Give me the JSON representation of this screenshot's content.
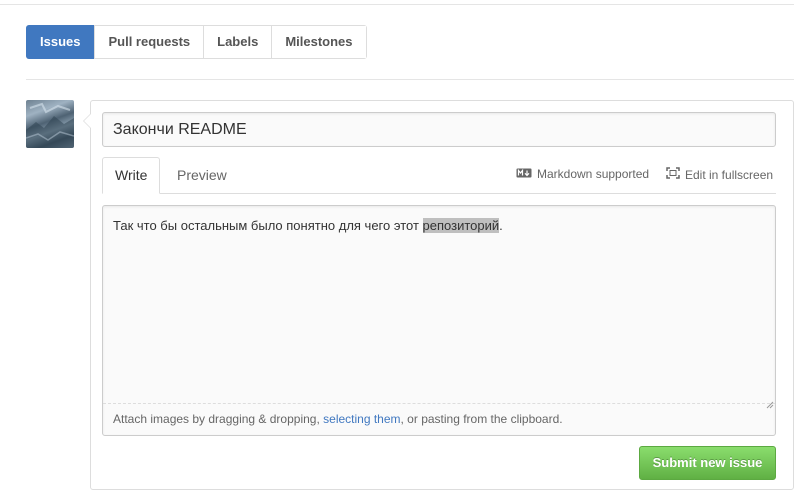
{
  "nav": {
    "tabs": [
      {
        "label": "Issues",
        "active": true
      },
      {
        "label": "Pull requests",
        "active": false
      },
      {
        "label": "Labels",
        "active": false
      },
      {
        "label": "Milestones",
        "active": false
      }
    ]
  },
  "form": {
    "title_value": "Закончи README",
    "tabs": {
      "write": "Write",
      "preview": "Preview"
    },
    "markdown_label": "Markdown supported",
    "fullscreen_label": "Edit in fullscreen",
    "body_text_before": "Так что бы остальным было понятно для чего этот ",
    "body_text_selected": "репозиторий",
    "body_text_after": ".",
    "attach_prefix": "Attach images by dragging & dropping, ",
    "attach_link": "selecting them",
    "attach_suffix": ", or pasting from the clipboard.",
    "submit_label": "Submit new issue"
  },
  "colors": {
    "accent": "#4078c0",
    "submit_green": "#60b044"
  },
  "icons": [
    "markdown-icon",
    "fullscreen-icon",
    "resize-grip-icon"
  ]
}
